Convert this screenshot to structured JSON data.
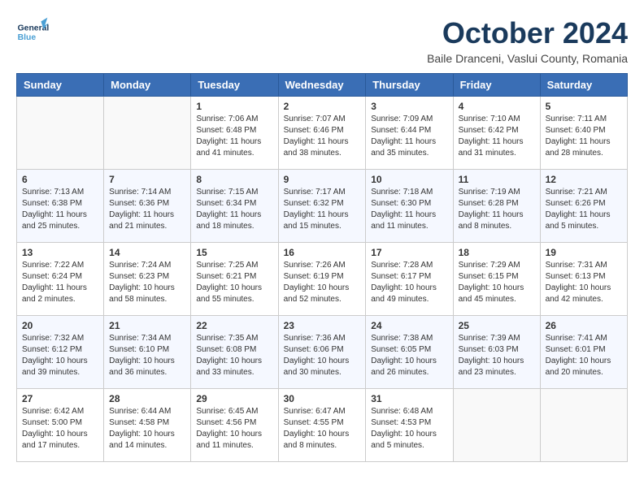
{
  "header": {
    "logo_general": "General",
    "logo_blue": "Blue",
    "month_title": "October 2024",
    "subtitle": "Baile Dranceni, Vaslui County, Romania"
  },
  "days_of_week": [
    "Sunday",
    "Monday",
    "Tuesday",
    "Wednesday",
    "Thursday",
    "Friday",
    "Saturday"
  ],
  "weeks": [
    [
      {
        "day": "",
        "info": ""
      },
      {
        "day": "",
        "info": ""
      },
      {
        "day": "1",
        "info": "Sunrise: 7:06 AM\nSunset: 6:48 PM\nDaylight: 11 hours and 41 minutes."
      },
      {
        "day": "2",
        "info": "Sunrise: 7:07 AM\nSunset: 6:46 PM\nDaylight: 11 hours and 38 minutes."
      },
      {
        "day": "3",
        "info": "Sunrise: 7:09 AM\nSunset: 6:44 PM\nDaylight: 11 hours and 35 minutes."
      },
      {
        "day": "4",
        "info": "Sunrise: 7:10 AM\nSunset: 6:42 PM\nDaylight: 11 hours and 31 minutes."
      },
      {
        "day": "5",
        "info": "Sunrise: 7:11 AM\nSunset: 6:40 PM\nDaylight: 11 hours and 28 minutes."
      }
    ],
    [
      {
        "day": "6",
        "info": "Sunrise: 7:13 AM\nSunset: 6:38 PM\nDaylight: 11 hours and 25 minutes."
      },
      {
        "day": "7",
        "info": "Sunrise: 7:14 AM\nSunset: 6:36 PM\nDaylight: 11 hours and 21 minutes."
      },
      {
        "day": "8",
        "info": "Sunrise: 7:15 AM\nSunset: 6:34 PM\nDaylight: 11 hours and 18 minutes."
      },
      {
        "day": "9",
        "info": "Sunrise: 7:17 AM\nSunset: 6:32 PM\nDaylight: 11 hours and 15 minutes."
      },
      {
        "day": "10",
        "info": "Sunrise: 7:18 AM\nSunset: 6:30 PM\nDaylight: 11 hours and 11 minutes."
      },
      {
        "day": "11",
        "info": "Sunrise: 7:19 AM\nSunset: 6:28 PM\nDaylight: 11 hours and 8 minutes."
      },
      {
        "day": "12",
        "info": "Sunrise: 7:21 AM\nSunset: 6:26 PM\nDaylight: 11 hours and 5 minutes."
      }
    ],
    [
      {
        "day": "13",
        "info": "Sunrise: 7:22 AM\nSunset: 6:24 PM\nDaylight: 11 hours and 2 minutes."
      },
      {
        "day": "14",
        "info": "Sunrise: 7:24 AM\nSunset: 6:23 PM\nDaylight: 10 hours and 58 minutes."
      },
      {
        "day": "15",
        "info": "Sunrise: 7:25 AM\nSunset: 6:21 PM\nDaylight: 10 hours and 55 minutes."
      },
      {
        "day": "16",
        "info": "Sunrise: 7:26 AM\nSunset: 6:19 PM\nDaylight: 10 hours and 52 minutes."
      },
      {
        "day": "17",
        "info": "Sunrise: 7:28 AM\nSunset: 6:17 PM\nDaylight: 10 hours and 49 minutes."
      },
      {
        "day": "18",
        "info": "Sunrise: 7:29 AM\nSunset: 6:15 PM\nDaylight: 10 hours and 45 minutes."
      },
      {
        "day": "19",
        "info": "Sunrise: 7:31 AM\nSunset: 6:13 PM\nDaylight: 10 hours and 42 minutes."
      }
    ],
    [
      {
        "day": "20",
        "info": "Sunrise: 7:32 AM\nSunset: 6:12 PM\nDaylight: 10 hours and 39 minutes."
      },
      {
        "day": "21",
        "info": "Sunrise: 7:34 AM\nSunset: 6:10 PM\nDaylight: 10 hours and 36 minutes."
      },
      {
        "day": "22",
        "info": "Sunrise: 7:35 AM\nSunset: 6:08 PM\nDaylight: 10 hours and 33 minutes."
      },
      {
        "day": "23",
        "info": "Sunrise: 7:36 AM\nSunset: 6:06 PM\nDaylight: 10 hours and 30 minutes."
      },
      {
        "day": "24",
        "info": "Sunrise: 7:38 AM\nSunset: 6:05 PM\nDaylight: 10 hours and 26 minutes."
      },
      {
        "day": "25",
        "info": "Sunrise: 7:39 AM\nSunset: 6:03 PM\nDaylight: 10 hours and 23 minutes."
      },
      {
        "day": "26",
        "info": "Sunrise: 7:41 AM\nSunset: 6:01 PM\nDaylight: 10 hours and 20 minutes."
      }
    ],
    [
      {
        "day": "27",
        "info": "Sunrise: 6:42 AM\nSunset: 5:00 PM\nDaylight: 10 hours and 17 minutes."
      },
      {
        "day": "28",
        "info": "Sunrise: 6:44 AM\nSunset: 4:58 PM\nDaylight: 10 hours and 14 minutes."
      },
      {
        "day": "29",
        "info": "Sunrise: 6:45 AM\nSunset: 4:56 PM\nDaylight: 10 hours and 11 minutes."
      },
      {
        "day": "30",
        "info": "Sunrise: 6:47 AM\nSunset: 4:55 PM\nDaylight: 10 hours and 8 minutes."
      },
      {
        "day": "31",
        "info": "Sunrise: 6:48 AM\nSunset: 4:53 PM\nDaylight: 10 hours and 5 minutes."
      },
      {
        "day": "",
        "info": ""
      },
      {
        "day": "",
        "info": ""
      }
    ]
  ]
}
